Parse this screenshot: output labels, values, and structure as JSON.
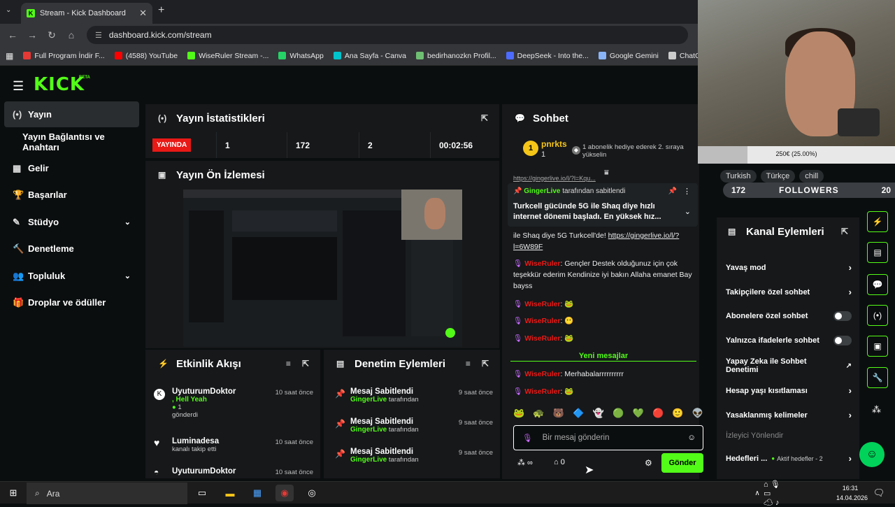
{
  "browser": {
    "tab_title": "Stream - Kick Dashboard",
    "new_tab": "+",
    "url": "dashboard.kick.com/stream",
    "bookmarks": [
      {
        "label": "Full Program İndir F...",
        "color": "#e53935"
      },
      {
        "label": "(4588) YouTube",
        "color": "#ff0000"
      },
      {
        "label": "WiseRuler Stream -...",
        "color": "#53fc18"
      },
      {
        "label": "WhatsApp",
        "color": "#25d366"
      },
      {
        "label": "Ana Sayfa - Canva",
        "color": "#00c4cc"
      },
      {
        "label": "bedirhanozkn Profil...",
        "color": "#6fbf73"
      },
      {
        "label": "DeepSeek - Into the...",
        "color": "#4d6bfe"
      },
      {
        "label": "Google Gemini",
        "color": "#8ab4f8"
      },
      {
        "label": "ChatGPT",
        "color": "#cccccc"
      }
    ]
  },
  "brand": {
    "logo": "KICK",
    "beta": "BETA"
  },
  "sidebar": [
    {
      "label": "Yayın",
      "icon": "(•)"
    },
    {
      "label": "Yayın Bağlantısı ve Anahtarı",
      "icon": ""
    },
    {
      "label": "Gelir",
      "icon": "▦"
    },
    {
      "label": "Başarılar",
      "icon": "🏆"
    },
    {
      "label": "Stüdyo",
      "icon": "✎",
      "chev": "⌄"
    },
    {
      "label": "Denetleme",
      "icon": "🔨"
    },
    {
      "label": "Topluluk",
      "icon": "👥",
      "chev": "⌄"
    },
    {
      "label": "Droplar ve ödüller",
      "icon": "🎁"
    }
  ],
  "stats": {
    "title": "Yayın İstatistikleri",
    "live": "YAYINDA",
    "viewers": "1",
    "followers": "172",
    "subs": "2",
    "duration": "00:02:56"
  },
  "preview": {
    "title": "Yayın Ön İzlemesi"
  },
  "activity": {
    "title": "Etkinlik Akışı",
    "items": [
      {
        "user": "UyuturumDoktor",
        "msg": ", Hell Yeah",
        "sub": "1",
        "extra": "gönderdi",
        "time": "10 saat önce"
      },
      {
        "user": "Luminadesa",
        "msg": "kanalı takip etti",
        "time": "10 saat önce"
      },
      {
        "user": "UyuturumDoktor",
        "msg": "",
        "time": "10 saat önce"
      }
    ]
  },
  "moderation": {
    "title": "Denetim Eylemleri",
    "items": [
      {
        "title": "Mesaj Sabitlendi",
        "user": "GingerLive",
        "suffix": "tarafından",
        "time": "9 saat önce"
      },
      {
        "title": "Mesaj Sabitlendi",
        "user": "GingerLive",
        "suffix": "tarafından",
        "time": "9 saat önce"
      },
      {
        "title": "Mesaj Sabitlendi",
        "user": "GingerLive",
        "suffix": "tarafından",
        "time": "9 saat önce"
      }
    ]
  },
  "chat": {
    "title": "Sohbet",
    "top_user": "pnrkts",
    "top_count": "1",
    "gift_note": "1 abonelik hediye ederek 2. sıraya yükselin",
    "pinned_by": "GingerLive",
    "pinned_suffix": "tarafından sabitlendi",
    "pinned_text": "Turkcell gücünde 5G ile Shaq diye hızlı internet dönemi başladı. En yüksek hız...",
    "cont_text": "ile Shaq diye 5G Turkcell'de! ",
    "cont_link": "https://gingerlive.io/l/?l=6W89F",
    "partial_link": "https://gingerlive.io/l/?l=Kqu...",
    "msg1_user": "WiseRuler",
    "msg1_text": "Gençler Destek olduğunuz için çok teşekkür ederim Kendinize iyi bakın Allaha emanet Bay bayss",
    "new_messages": "Yeni mesajlar",
    "msg_last": "Merhabalarrrrrrrrrr",
    "input_placeholder": "Bir mesaj gönderin",
    "points": "0",
    "send": "Gönder"
  },
  "overlay": {
    "goal": "250€ (25.00%)",
    "goal_pct": 25,
    "tags": [
      "Turkish",
      "Türkçe",
      "chill"
    ],
    "followers_count": "172",
    "followers_label": "FOLLOWERS",
    "followers_right": "20"
  },
  "kanal": {
    "title": "Kanal Eylemleri",
    "items": [
      {
        "label": "Yavaş mod",
        "type": "arrow"
      },
      {
        "label": "Takipçilere özel sohbet",
        "type": "arrow"
      },
      {
        "label": "Abonelere özel sohbet",
        "type": "toggle"
      },
      {
        "label": "Yalnızca ifadelerle sohbet",
        "type": "toggle"
      },
      {
        "label": "Yapay Zeka ile Sohbet Denetimi",
        "type": "ext"
      },
      {
        "label": "Hesap yaşı kısıtlaması",
        "type": "arrow"
      },
      {
        "label": "Yasaklanmış kelimeler",
        "type": "arrow"
      }
    ],
    "section": "İzleyici Yönlendir",
    "goals_label": "Hedefleri ...",
    "goals_status": "Aktif hedefler - 2"
  },
  "taskbar": {
    "search": "Ara",
    "time": "16:31",
    "date": "14.04.2026"
  }
}
